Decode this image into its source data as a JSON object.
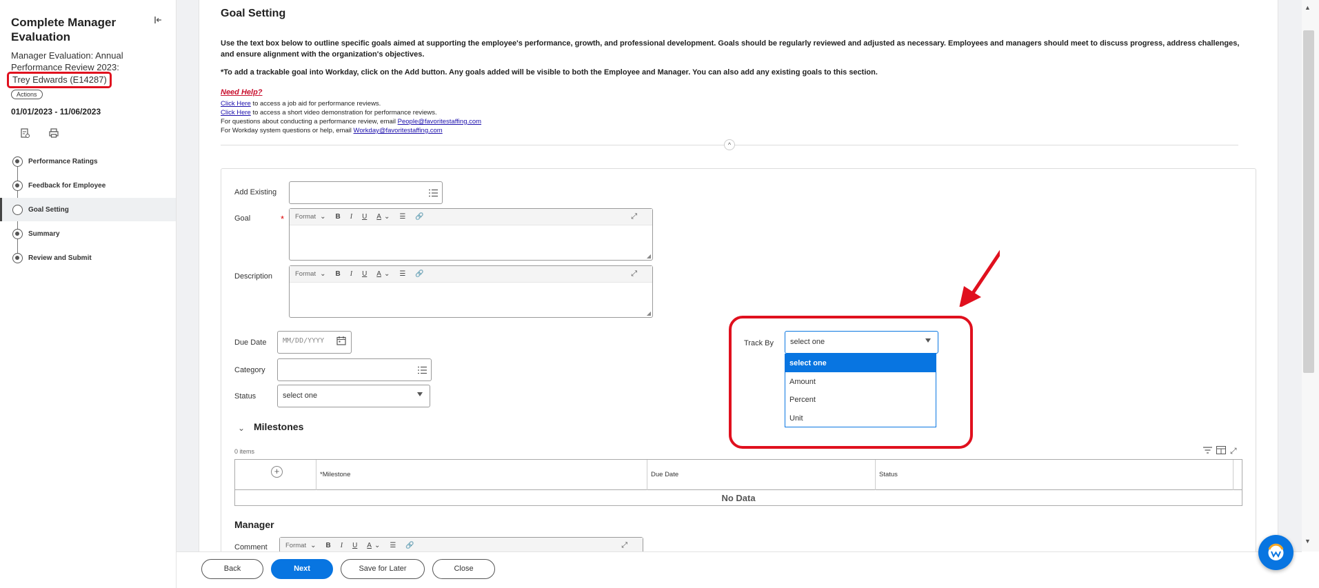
{
  "sidebar": {
    "title": "Complete Manager Evaluation",
    "subtitle": "Manager Evaluation: Annual Performance Review 2023:",
    "employee": "Trey Edwards (E14287)",
    "actions_label": "Actions",
    "dates": "01/01/2023 - 11/06/2023",
    "steps": [
      {
        "label": "Performance Ratings",
        "state": "done"
      },
      {
        "label": "Feedback for Employee",
        "state": "done"
      },
      {
        "label": "Goal Setting",
        "state": "current"
      },
      {
        "label": "Summary",
        "state": "done"
      },
      {
        "label": "Review and Submit",
        "state": "done"
      }
    ]
  },
  "section": {
    "title": "Goal Setting",
    "intro1": "Use the text box below to outline specific goals aimed at supporting the employee's performance, growth, and professional development. Goals should be regularly reviewed and adjusted as necessary. Employees and managers should meet to discuss progress, address challenges, and ensure alignment with the organization's objectives.",
    "intro2": "*To add a trackable goal into Workday, click on the Add button. Any goals added will be visible to both the Employee and Manager.  You can also add any existing goals to this section.",
    "need_help": "Need Help?",
    "help1_link": "Click Here",
    "help1_text": " to access a job aid for performance reviews.",
    "help2_link": "Click Here",
    "help2_text": " to access a short video demonstration for performance reviews.",
    "help3_text": "For questions about conducting a performance review, email ",
    "help3_link": "People@favoritestaffing.com",
    "help4_text": "For Workday system questions or help, email ",
    "help4_link": "Workday@favoritestaffing.com"
  },
  "form": {
    "add_existing_label": "Add Existing",
    "goal_label": "Goal",
    "description_label": "Description",
    "due_date_label": "Due Date",
    "due_date_placeholder": "MM/DD/YYYY",
    "category_label": "Category",
    "status_label": "Status",
    "status_value": "select one",
    "rte": {
      "format": "Format",
      "bold": "B",
      "italic": "I",
      "underline": "U",
      "color": "A"
    },
    "track_by_label": "Track By",
    "track_by_value": "select one",
    "track_by_options": [
      "select one",
      "Amount",
      "Percent",
      "Unit"
    ],
    "track_by_selected": "select one"
  },
  "milestones": {
    "title": "Milestones",
    "count": "0 items",
    "columns": [
      "*Milestone",
      "Due Date",
      "Status"
    ],
    "empty": "No Data"
  },
  "manager": {
    "title": "Manager",
    "comment_label": "Comment"
  },
  "footer": {
    "back": "Back",
    "next": "Next",
    "save_later": "Save for Later",
    "close": "Close"
  },
  "colors": {
    "primary": "#0875e1",
    "highlight": "#e0101e"
  }
}
